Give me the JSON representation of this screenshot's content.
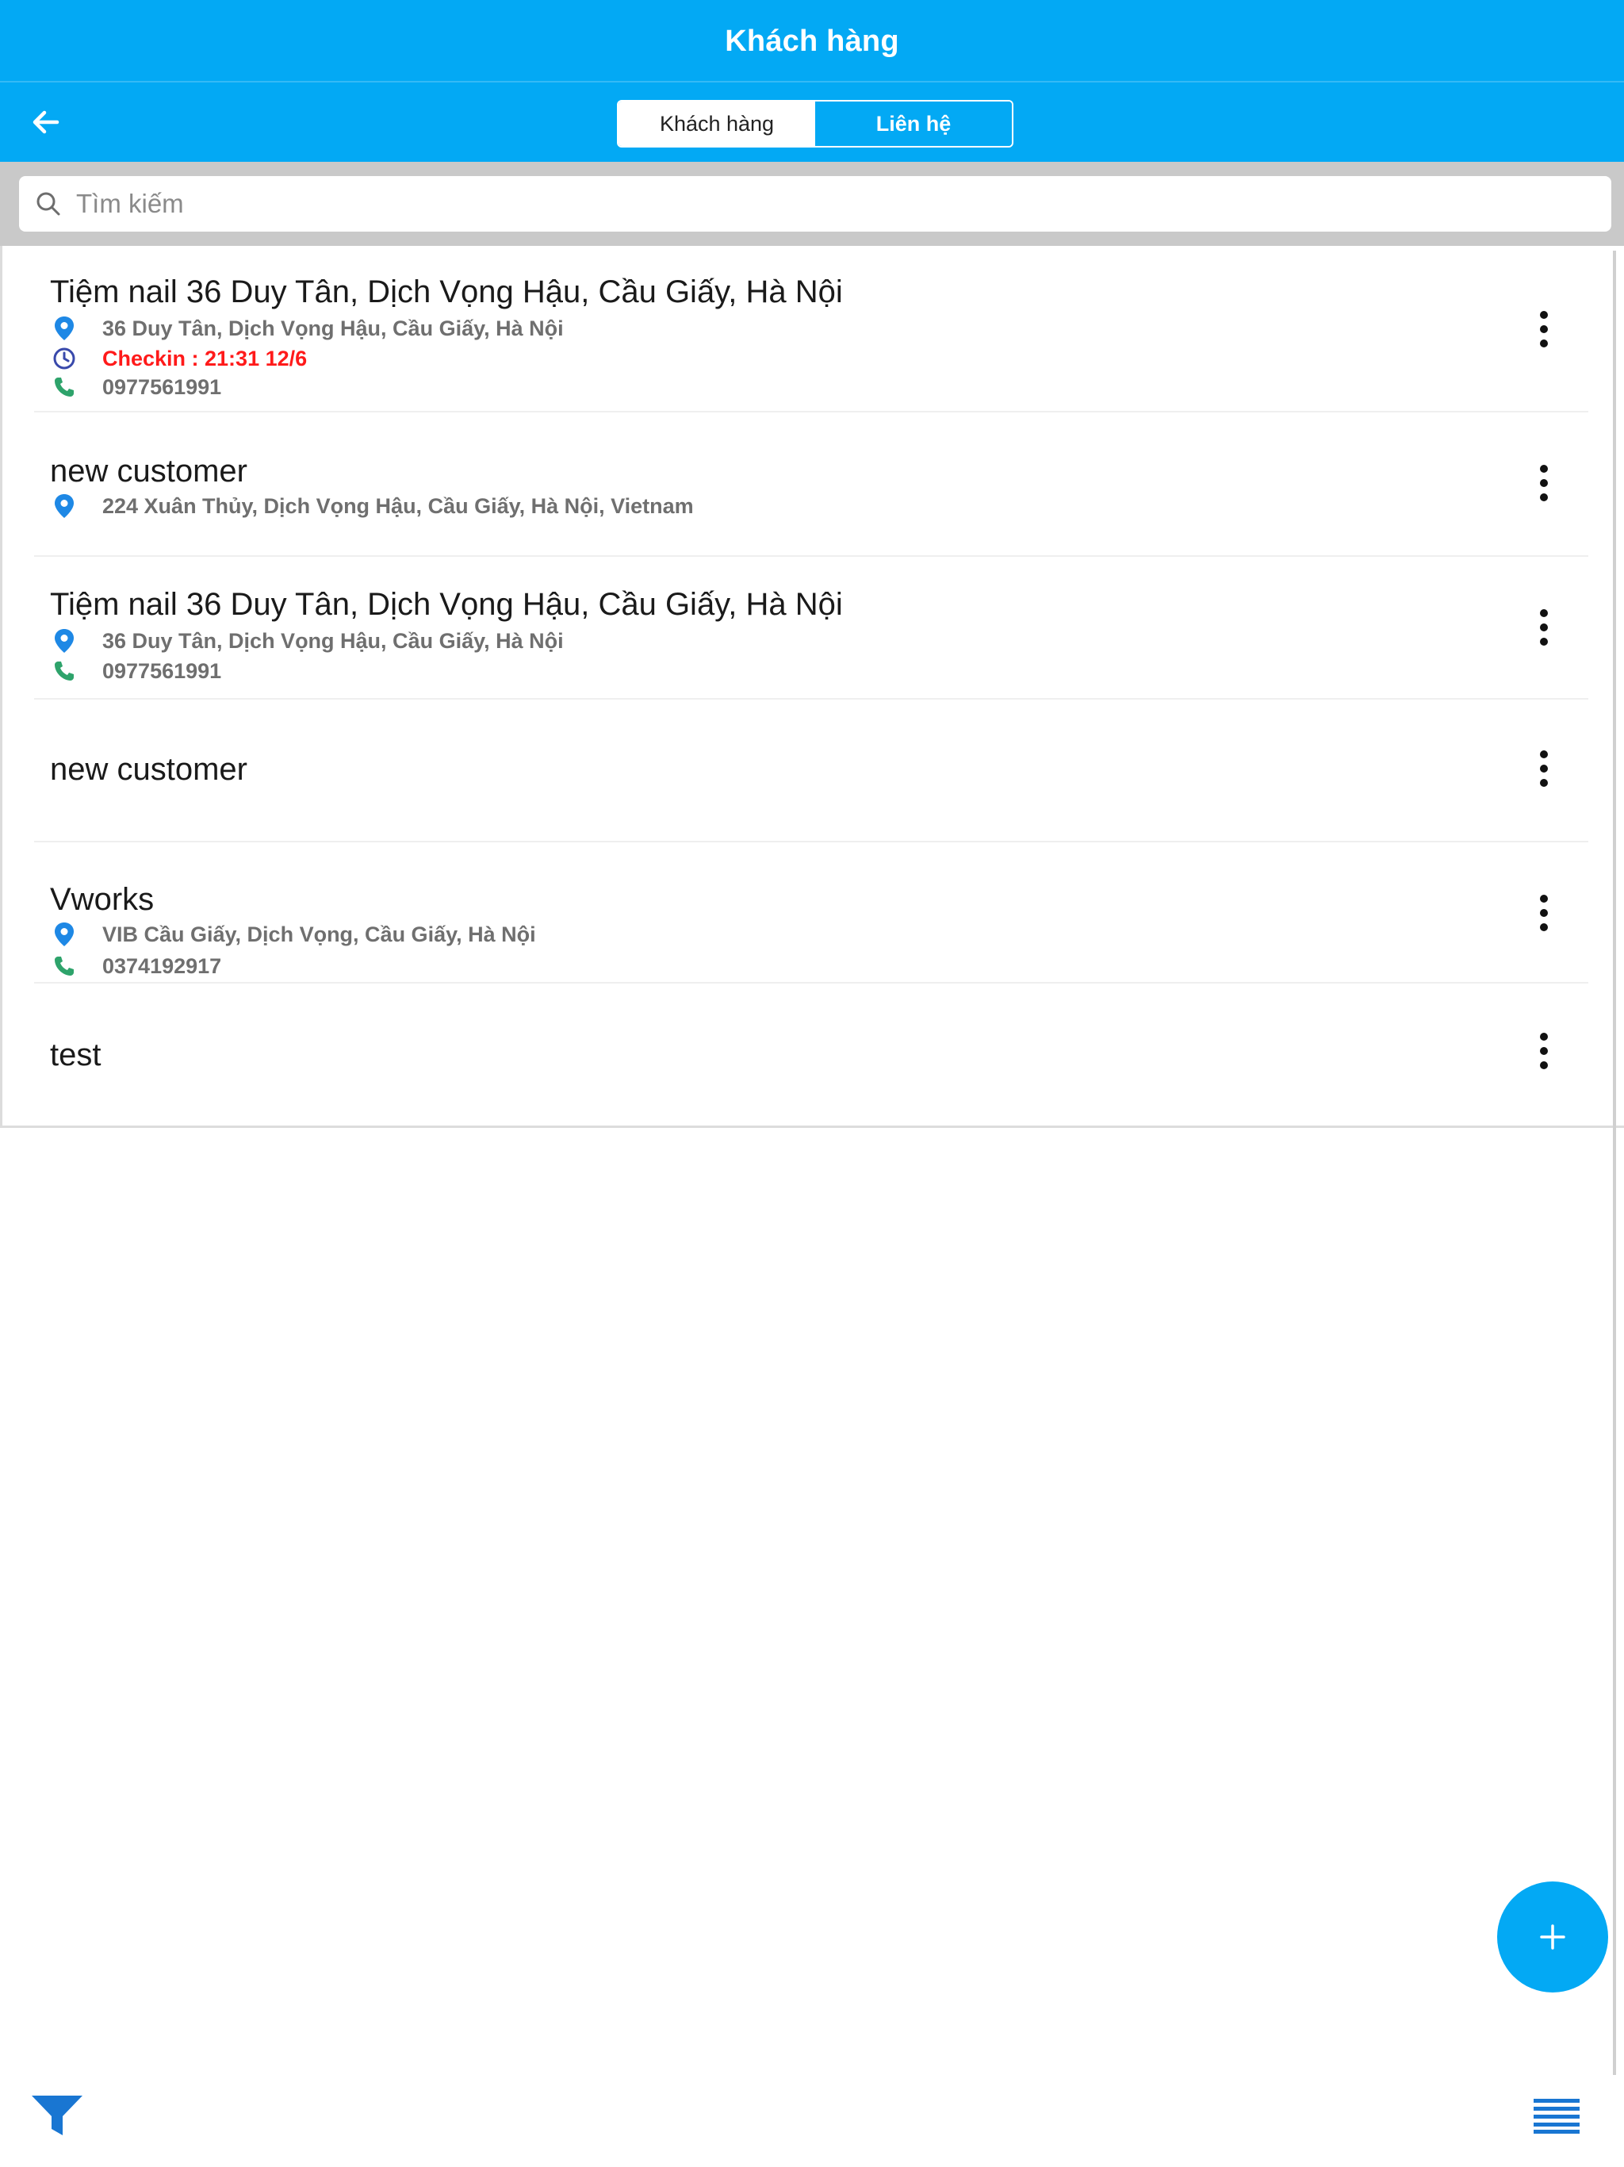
{
  "header": {
    "title": "Khách hàng"
  },
  "tabs": [
    {
      "label": "Khách hàng",
      "active": true
    },
    {
      "label": "Liên hệ",
      "active": false
    }
  ],
  "search": {
    "placeholder": "Tìm kiếm",
    "value": ""
  },
  "colors": {
    "primary": "#03a9f4",
    "checkin": "#ff1a1a",
    "pin": "#1e88e5",
    "phone": "#2ea36b",
    "clock": "#3949ab"
  },
  "customers": [
    {
      "name": "Tiệm nail 36 Duy Tân, Dịch Vọng Hậu, Cầu Giấy, Hà Nội",
      "address": "36 Duy Tân, Dịch Vọng Hậu, Cầu Giấy, Hà Nội",
      "checkin": "Checkin : 21:31 12/6",
      "phone": "0977561991"
    },
    {
      "name": "new customer",
      "address": "224 Xuân Thủy, Dịch Vọng Hậu, Cầu Giấy, Hà Nội, Vietnam"
    },
    {
      "name": "Tiệm nail 36 Duy Tân, Dịch Vọng Hậu, Cầu Giấy, Hà Nội",
      "address": "36 Duy Tân, Dịch Vọng Hậu, Cầu Giấy, Hà Nội",
      "phone": "0977561991"
    },
    {
      "name": "new customer"
    },
    {
      "name": "Vworks",
      "address": "VIB Cầu Giấy, Dịch Vọng, Cầu Giấy, Hà Nội",
      "phone": "0374192917"
    },
    {
      "name": "test"
    }
  ],
  "icons": {
    "back": "arrow-left-icon",
    "search": "search-icon",
    "address": "map-pin-icon",
    "checkin": "clock-icon",
    "phone": "phone-icon",
    "more": "more-vertical-icon",
    "add": "plus-icon",
    "filter": "filter-icon",
    "menu": "menu-lines-icon"
  }
}
